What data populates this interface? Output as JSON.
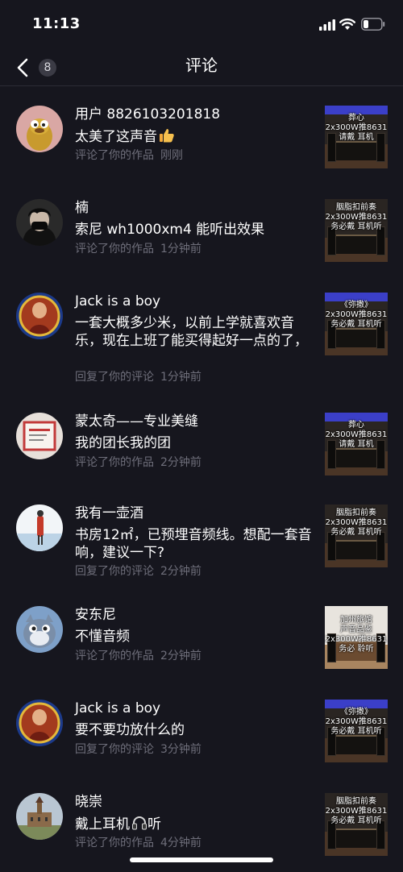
{
  "status_bar": {
    "time": "11:13",
    "icons": [
      "signal-icon",
      "wifi-icon",
      "battery-icon"
    ]
  },
  "header": {
    "back_badge": "8",
    "title": "评论"
  },
  "colors": {
    "background": "#16161e",
    "meta_text": "#6e6e7a",
    "divider": "#2b2b35"
  },
  "notifications": [
    {
      "user": "用户 8826103201818",
      "text": "太美了这声音",
      "emoji": "thumbs-up-icon",
      "action": "评论了你的作品",
      "time": "刚刚",
      "thumb_caption": "葬心\n2x300W推8631\n请戴   耳机"
    },
    {
      "user": "楠",
      "text": "索尼 wh1000xm4 能听出效果",
      "action": "评论了你的作品",
      "time": "1分钟前",
      "thumb_caption": "胭脂扣前奏\n2x300W推8631\n务必戴   耳机听"
    },
    {
      "user": "Jack is a boy",
      "text": "一套大概多少米，以前上学就喜欢音乐，现在上班了能买得起好一点的了，",
      "action": "回复了你的评论",
      "time": "1分钟前",
      "thumb_caption": "《弥撒》\n2x300W推8631\n务必戴   耳机听"
    },
    {
      "user": "蒙太奇——专业美缝",
      "text": "我的团长我的团",
      "action": "评论了你的作品",
      "time": "2分钟前",
      "thumb_caption": "葬心\n2x300W推8631\n请戴   耳机"
    },
    {
      "user": "我有一壶酒",
      "text": "书房12㎡，已预埋音频线。想配一套音响，建议一下?",
      "action": "回复了你的评论",
      "time": "2分钟前",
      "thumb_caption": "胭脂扣前奏\n2x300W推8631\n务必戴   耳机听"
    },
    {
      "user": "安东尼",
      "text": "不懂音频",
      "action": "评论了你的作品",
      "time": "2分钟前",
      "thumb_caption": "加州旅馆\n声音品鉴\n2x300W推8631\n务必   聆听"
    },
    {
      "user": "Jack is a boy",
      "text": "要不要功放什么的",
      "action": "回复了你的评论",
      "time": "3分钟前",
      "thumb_caption": "《弥撒》\n2x300W推8631\n务必戴   耳机听"
    },
    {
      "user": "晓崇",
      "text": "戴上耳机",
      "text_after": "听",
      "emoji": "headphones-icon",
      "action": "评论了你的作品",
      "time": "4分钟前",
      "thumb_caption": "胭脂扣前奏\n2x300W推8631\n务必戴   耳机听"
    }
  ]
}
